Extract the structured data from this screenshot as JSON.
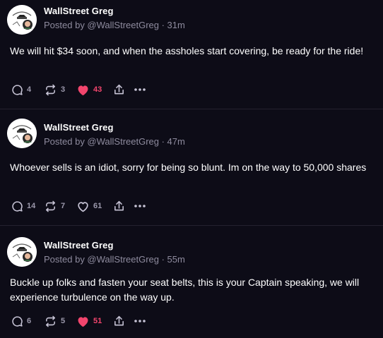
{
  "colors": {
    "background": "#0d0c17",
    "divider": "#24222f",
    "meta_text": "#8e8b9e",
    "liked": "#f2456d"
  },
  "posts": [
    {
      "author": "WallStreet Greg",
      "meta": "Posted by @WallStreetGreg · 31m",
      "text": "We will hit $34 soon, and when the assholes start covering, be ready for the ride!",
      "replies": "4",
      "reposts": "3",
      "likes": "43",
      "liked": true
    },
    {
      "author": "WallStreet Greg",
      "meta": "Posted by @WallStreetGreg · 47m",
      "text": "Whoever sells is an idiot, sorry for being so blunt. Im on the way to 50,000 shares",
      "replies": "14",
      "reposts": "7",
      "likes": "61",
      "liked": false
    },
    {
      "author": "WallStreet Greg",
      "meta": "Posted by @WallStreetGreg · 55m",
      "text": "Buckle up folks and fasten your seat belts, this is your Captain speaking, we will experience turbulence on the way up.",
      "replies": "6",
      "reposts": "5",
      "likes": "51",
      "liked": true
    }
  ],
  "icons": {
    "reply": "comment-icon",
    "repost": "repost-icon",
    "like": "heart-icon",
    "share": "share-icon",
    "more": "more-icon"
  }
}
